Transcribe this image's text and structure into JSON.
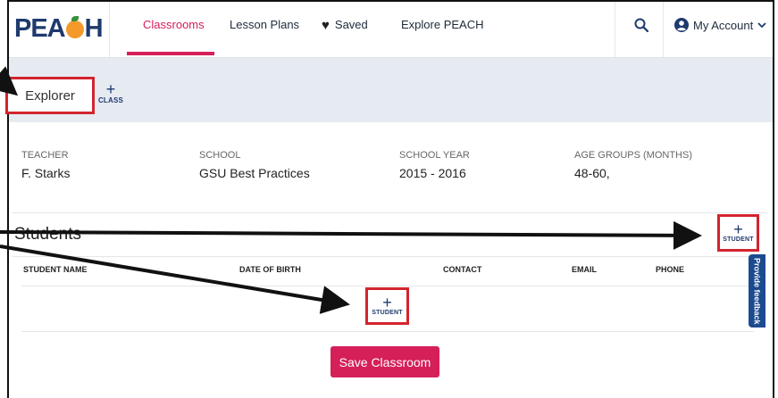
{
  "brand": {
    "logo_text_left": "PEA",
    "logo_text_right": "H"
  },
  "nav": {
    "items": [
      {
        "label": "Classrooms",
        "active": true
      },
      {
        "label": "Lesson Plans",
        "active": false
      },
      {
        "label": "Saved",
        "active": false,
        "icon": "heart-icon"
      },
      {
        "label": "Explore PEACH",
        "active": false
      }
    ],
    "account_label": "My Account"
  },
  "classbar": {
    "tab_label": "Explorer",
    "add_class_plus": "+",
    "add_class_label": "CLASS"
  },
  "info": {
    "teacher_label": "TEACHER",
    "teacher_value": "F. Starks",
    "school_label": "SCHOOL",
    "school_value": "GSU Best Practices",
    "year_label": "SCHOOL YEAR",
    "year_value": "2015 - 2016",
    "age_label": "AGE GROUPS (MONTHS)",
    "age_value": "48-60,"
  },
  "students": {
    "title": "Students",
    "add_plus": "+",
    "add_label": "STUDENT",
    "columns": [
      "STUDENT NAME",
      "DATE OF BIRTH",
      "CONTACT",
      "EMAIL",
      "PHONE"
    ]
  },
  "save_button": "Save Classroom",
  "feedback_label": "Provide feedback",
  "colors": {
    "accent": "#d51f58",
    "navy": "#1e3a6e",
    "highlight": "#d3242e",
    "band": "#e6ebf2"
  }
}
